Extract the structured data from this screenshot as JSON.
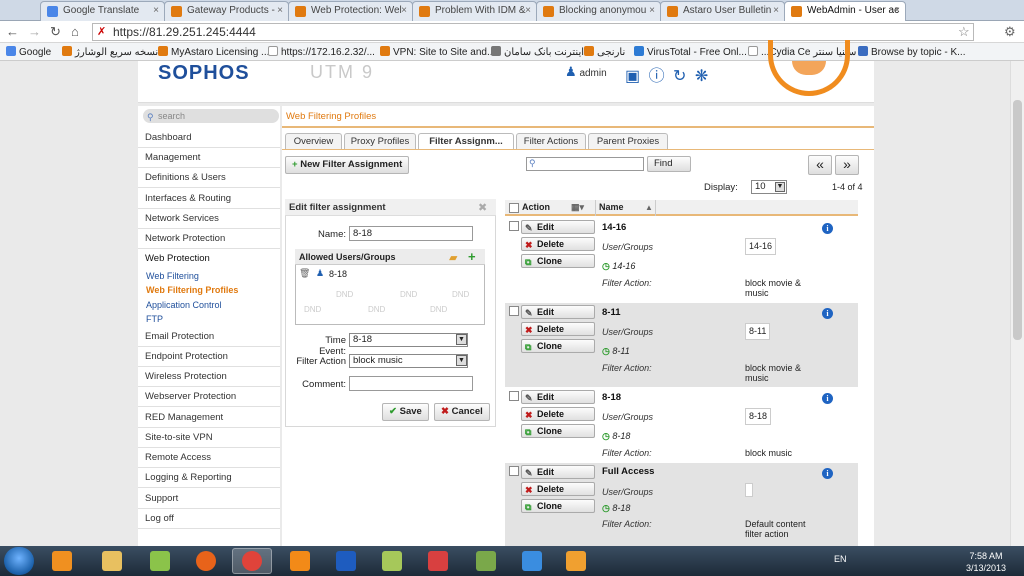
{
  "browser": {
    "tabs": [
      {
        "label": "Google Translate",
        "color": "#4a86e8"
      },
      {
        "label": "Gateway Products - ",
        "color": "#e07a10"
      },
      {
        "label": "Web Protection: Wel",
        "color": "#e07a10"
      },
      {
        "label": "Problem With IDM &",
        "color": "#e07a10"
      },
      {
        "label": "Blocking anonymou",
        "color": "#e07a10"
      },
      {
        "label": "Astaro User Bulletin",
        "color": "#e07a10"
      },
      {
        "label": "WebAdmin - User ac",
        "color": "#e07a10"
      }
    ],
    "close_glyph": "×",
    "url": "https://81.29.251.245:4444",
    "bookmarks": [
      {
        "label": "Google",
        "color": "#4a86e8"
      },
      {
        "label": "نسخه سریع الوشارژ",
        "color": "#e07a10"
      },
      {
        "label": "MyAstaro Licensing ...",
        "color": "#e07a10"
      },
      {
        "label": "https://172.16.2.32/...",
        "color": "#999"
      },
      {
        "label": "VPN: Site to Site and...",
        "color": "#e07a10"
      },
      {
        "label": "اینترنت بانک سامان",
        "color": "#999"
      },
      {
        "label": "نارنجی",
        "color": "#e07a10"
      },
      {
        "label": "VirusTotal - Free Onl...",
        "color": "#2d7bd4"
      },
      {
        "label": "...Cydia Ce سینیا سنتر",
        "color": "#999"
      },
      {
        "label": "Browse by topic - K...",
        "color": "#3a6cc0"
      }
    ]
  },
  "header": {
    "logo": "SOPHOS",
    "product": "UTM 9",
    "user": "admin"
  },
  "sidebar": {
    "search_placeholder": "search",
    "items": [
      "Dashboard",
      "Management",
      "Definitions & Users",
      "Interfaces & Routing",
      "Network Services",
      "Network Protection",
      "Web Protection"
    ],
    "web_protection_sub": [
      "Web Filtering",
      "Web Filtering Profiles",
      "Application Control",
      "FTP"
    ],
    "items_after": [
      "Email Protection",
      "Endpoint Protection",
      "Wireless Protection",
      "Webserver Protection",
      "RED Management",
      "Site-to-site VPN",
      "Remote Access",
      "Logging & Reporting",
      "Support",
      "Log off"
    ]
  },
  "main": {
    "breadcrumb": "Web Filtering Profiles",
    "tabs": [
      "Overview",
      "Proxy Profiles",
      "Filter Assignm...",
      "Filter Actions",
      "Parent Proxies"
    ],
    "new_button": "New Filter Assignment",
    "find_button": "Find",
    "prev_btn": "«",
    "next_btn": "»",
    "display_label": "Display:",
    "display_value": "10",
    "count": "1-4 of 4",
    "dnd": "DND"
  },
  "edit_panel": {
    "title": "Edit filter assignment",
    "name_label": "Name:",
    "name_value": "8-18",
    "allowed_title": "Allowed Users/Groups",
    "allowed_item": "8-18",
    "time_label": "Time Event:",
    "time_value": "8-18",
    "action_label": "Filter Action",
    "action_value": "block music",
    "comment_label": "Comment:",
    "save": "Save",
    "cancel": "Cancel"
  },
  "list": {
    "col_action": "Action",
    "col_name": "Name",
    "btn_edit": "Edit",
    "btn_delete": "Delete",
    "btn_clone": "Clone",
    "lbl_users": "User/Groups",
    "lbl_action": "Filter Action:",
    "rows": [
      {
        "name": "14-16",
        "group": "14-16",
        "time": "14-16",
        "action": "block movie & music"
      },
      {
        "name": "8-11",
        "group": "8-11",
        "time": "8-11",
        "action": "block movie & music"
      },
      {
        "name": "8-18",
        "group": "8-18",
        "time": "8-18",
        "action": "block music"
      },
      {
        "name": "Full Access",
        "group": "8-18",
        "time": "",
        "action": "Default content filter action"
      }
    ]
  },
  "taskbar": {
    "lang": "EN",
    "time": "7:58 AM",
    "date": "3/13/2013"
  }
}
